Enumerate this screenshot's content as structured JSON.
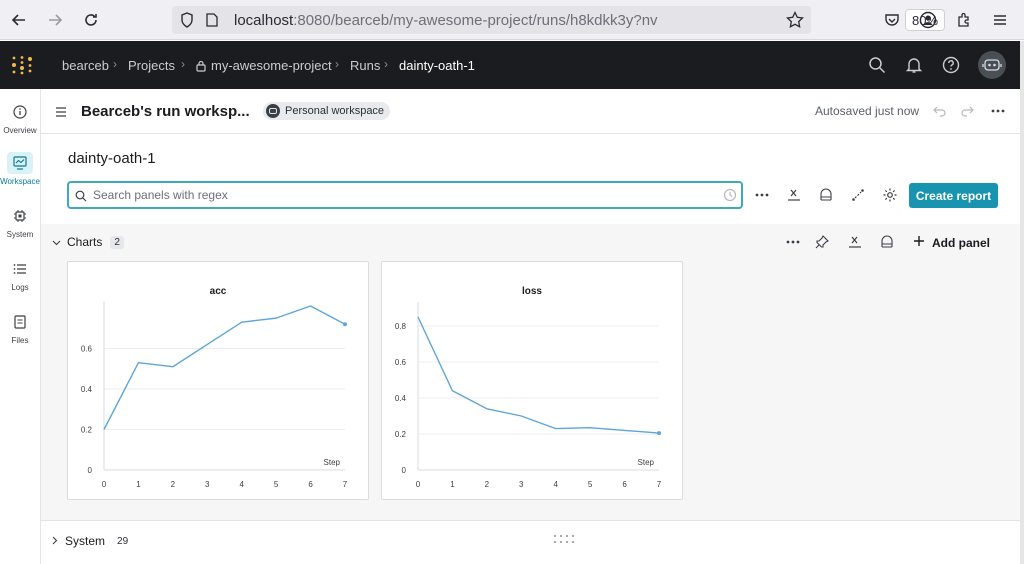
{
  "browser": {
    "url_host": "localhost",
    "url_rest": ":8080/bearceb/my-awesome-project/runs/h8kdkk3y?nv",
    "zoom": "80%"
  },
  "breadcrumb": {
    "entity": "bearceb",
    "projects": "Projects",
    "project": "my-awesome-project",
    "runs": "Runs",
    "run": "dainty-oath-1"
  },
  "sidebar": {
    "items": [
      {
        "label": "Overview",
        "icon": "info-icon"
      },
      {
        "label": "Workspace",
        "icon": "workspace-icon"
      },
      {
        "label": "System",
        "icon": "chip-icon"
      },
      {
        "label": "Logs",
        "icon": "list-icon"
      },
      {
        "label": "Files",
        "icon": "file-icon"
      }
    ]
  },
  "workspace": {
    "title": "Bearceb's run worksp...",
    "badge": "Personal workspace",
    "autosave": "Autosaved just now"
  },
  "run_title": "dainty-oath-1",
  "search": {
    "placeholder": "Search panels with regex",
    "value": ""
  },
  "actions": {
    "create_report": "Create report",
    "add_panel": "Add panel"
  },
  "sections": {
    "charts": {
      "label": "Charts",
      "count": "2"
    },
    "system": {
      "label": "System",
      "count": "29"
    }
  },
  "colors": {
    "accent": "#1894b0",
    "line": "#5fa5d9",
    "topbar": "#1a1c1f"
  },
  "chart_data": [
    {
      "type": "line",
      "title": "acc",
      "xlabel": "Step",
      "ylabel": "",
      "x": [
        0,
        1,
        2,
        3,
        4,
        5,
        6,
        7
      ],
      "series": [
        {
          "values": [
            0.2,
            0.53,
            0.51,
            0.62,
            0.73,
            0.75,
            0.81,
            0.72
          ]
        }
      ],
      "xlim": [
        0,
        7
      ],
      "ylim": [
        0,
        0.8
      ],
      "yticks": [
        "0",
        "0.2",
        "0.4",
        "0.6"
      ],
      "xticks": [
        "0",
        "1",
        "2",
        "3",
        "4",
        "5",
        "6",
        "7"
      ]
    },
    {
      "type": "line",
      "title": "loss",
      "xlabel": "Step",
      "ylabel": "",
      "x": [
        0,
        1,
        2,
        3,
        4,
        5,
        6,
        7
      ],
      "series": [
        {
          "values": [
            0.85,
            0.44,
            0.34,
            0.3,
            0.23,
            0.235,
            0.22,
            0.205
          ]
        }
      ],
      "xlim": [
        0,
        7
      ],
      "ylim": [
        0,
        0.9
      ],
      "yticks": [
        "0",
        "0.2",
        "0.4",
        "0.6",
        "0.8"
      ],
      "xticks": [
        "0",
        "1",
        "2",
        "3",
        "4",
        "5",
        "6",
        "7"
      ]
    }
  ]
}
